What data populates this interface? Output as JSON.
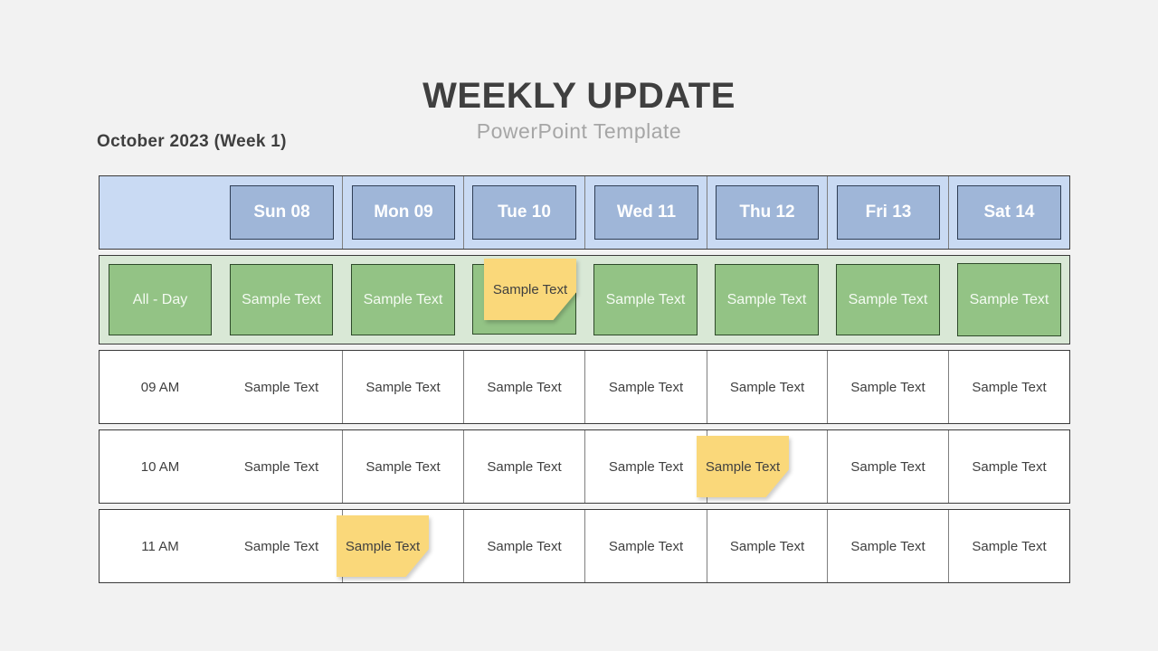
{
  "title": "WEEKLY UPDATE",
  "subtitle": "PowerPoint Template",
  "week_label": "October 2023 (Week 1)",
  "colors": {
    "header_band": "#c9daf3",
    "day_box": "#9fb6d8",
    "allday_band": "#d9e8d6",
    "allday_box": "#93c385",
    "sticky_note": "#fad87a",
    "background": "#f2f2f2"
  },
  "days": [
    "Sun 08",
    "Mon 09",
    "Tue 10",
    "Wed 11",
    "Thu 12",
    "Fri 13",
    "Sat 14"
  ],
  "all_day": {
    "label": "All - Day",
    "cells": [
      "Sample Text",
      "Sample Text",
      "",
      "Sample Text",
      "Sample Text",
      "Sample Text",
      "Sample Text"
    ]
  },
  "time_rows": [
    {
      "time": "09 AM",
      "cells": [
        "Sample Text",
        "Sample Text",
        "Sample Text",
        "Sample Text",
        "Sample Text",
        "Sample Text",
        "Sample Text"
      ]
    },
    {
      "time": "10 AM",
      "cells": [
        "Sample Text",
        "Sample Text",
        "Sample Text",
        "Sample Text",
        "",
        "Sample Text",
        "Sample Text"
      ]
    },
    {
      "time": "11 AM",
      "cells": [
        "Sample Text",
        "",
        "Sample Text",
        "Sample Text",
        "Sample Text",
        "Sample Text",
        "Sample Text"
      ]
    }
  ],
  "sticky_notes": [
    {
      "row": "All - Day",
      "day": "Tue 10",
      "text": "Sample Text"
    },
    {
      "row": "10 AM",
      "day": "Thu 12",
      "text": "Sample Text"
    },
    {
      "row": "11 AM",
      "day": "Mon 09",
      "text": "Sample Text"
    }
  ]
}
